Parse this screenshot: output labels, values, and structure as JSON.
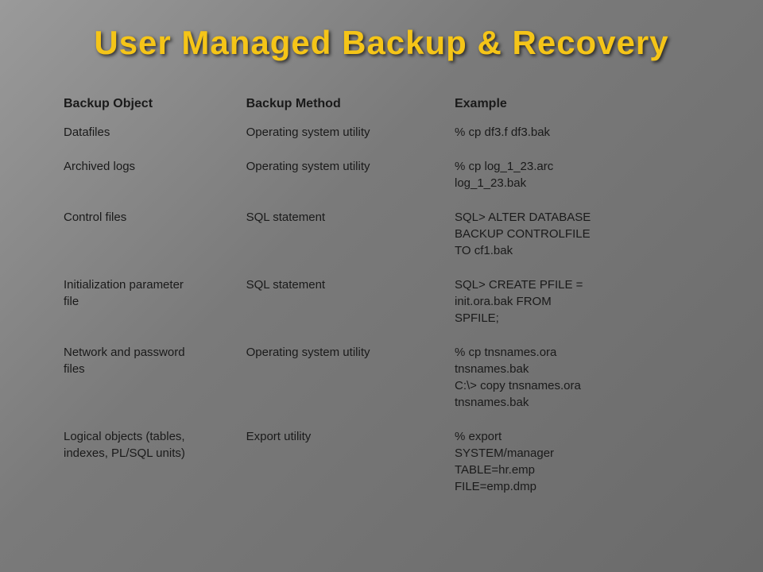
{
  "title": "User Managed Backup & Recovery",
  "table": {
    "headers": [
      "Backup Object",
      "Backup Method",
      "Example"
    ],
    "rows": [
      {
        "object": "Datafiles",
        "method": "Operating system utility",
        "example": "% cp df3.f df3.bak"
      },
      {
        "object": "Archived logs",
        "method": "Operating system utility",
        "example": "% cp log_1_23.arc\nlog_1_23.bak"
      },
      {
        "object": "Control files",
        "method": "SQL statement",
        "example": "SQL> ALTER DATABASE\nBACKUP CONTROLFILE\nTO cf1.bak"
      },
      {
        "object": "Initialization parameter\nfile",
        "method": "SQL statement",
        "example": "SQL> CREATE PFILE =\ninit.ora.bak FROM\nSPFILE;"
      },
      {
        "object": "Network and password\nfiles",
        "method": "Operating system utility",
        "example": "% cp tnsnames.ora\ntnsnames.bak\nC:\\> copy tnsnames.ora\ntnsnames.bak"
      },
      {
        "object": "Logical objects (tables,\nindexes, PL/SQL units)",
        "method": "Export utility",
        "example": "% export\nSYSTEM/manager\nTABLE=hr.emp\nFILE=emp.dmp"
      }
    ]
  }
}
